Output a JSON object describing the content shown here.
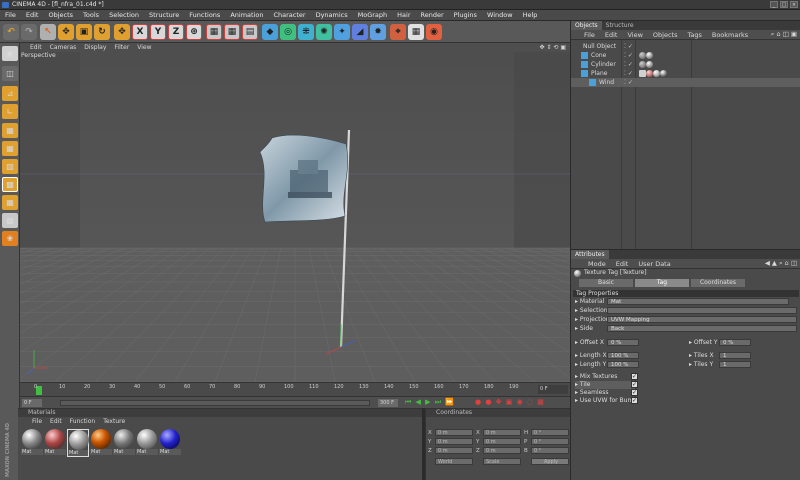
{
  "window": {
    "title": "CINEMA 4D - [fl_nfra_01.c4d *]",
    "controls": [
      "_",
      "□",
      "×"
    ]
  },
  "menu": [
    "File",
    "Edit",
    "Objects",
    "Tools",
    "Selection",
    "Structure",
    "Functions",
    "Animation",
    "Character",
    "Dynamics",
    "MoGraph",
    "Hair",
    "Render",
    "Plugins",
    "Window",
    "Help"
  ],
  "toolbar": {
    "axis_x": "X",
    "axis_y": "Y",
    "axis_z": "Z"
  },
  "viewport": {
    "menu": [
      "Edit",
      "Cameras",
      "Display",
      "Filter",
      "View"
    ],
    "label": "Perspective"
  },
  "timeline": {
    "ticks": [
      "0",
      "10",
      "20",
      "30",
      "40",
      "50",
      "60",
      "70",
      "80",
      "90",
      "100",
      "110",
      "120",
      "130",
      "140",
      "150",
      "160",
      "170",
      "180",
      "190"
    ],
    "end_frame": "0 F",
    "current_start": "0 F",
    "current_end": "300 F"
  },
  "materials": {
    "title": "Materials",
    "menu": [
      "File",
      "Edit",
      "Function",
      "Texture"
    ],
    "items": [
      {
        "label": "Mat",
        "color": "#c8c8c8"
      },
      {
        "label": "Mat",
        "color": "#d07070"
      },
      {
        "label": "Mat",
        "color": "#e0e0e0"
      },
      {
        "label": "Mat",
        "color": "#e07020"
      },
      {
        "label": "Mat",
        "color": "#b8b8b8"
      },
      {
        "label": "Mat",
        "color": "#d0d0d0"
      },
      {
        "label": "Mat",
        "color": "#2040d0"
      }
    ],
    "logo": "MAXON CINEMA 4D"
  },
  "coordinates": {
    "title": "Coordinates",
    "rows": [
      {
        "a": "X",
        "av": "0 m",
        "b": "X",
        "bv": "0 m",
        "c": "H",
        "cv": "0 °"
      },
      {
        "a": "Y",
        "av": "0 m",
        "b": "Y",
        "bv": "0 m",
        "c": "P",
        "cv": "0 °"
      },
      {
        "a": "Z",
        "av": "0 m",
        "b": "Z",
        "bv": "0 m",
        "c": "B",
        "cv": "0 °"
      }
    ],
    "mode1": "World",
    "mode2": "Scale",
    "apply": "Apply"
  },
  "objects": {
    "tabs": [
      "Objects",
      "Structure"
    ],
    "menu": [
      "File",
      "Edit",
      "View",
      "Objects",
      "Tags",
      "Bookmarks"
    ],
    "items": [
      {
        "name": "Null Object",
        "indent": 0
      },
      {
        "name": "Cone",
        "indent": 1
      },
      {
        "name": "Cylinder",
        "indent": 1
      },
      {
        "name": "Plane",
        "indent": 1
      },
      {
        "name": "Wind",
        "indent": 2
      }
    ]
  },
  "attributes": {
    "tab": "Attributes",
    "menu": [
      "Mode",
      "Edit",
      "User Data"
    ],
    "header": "Texture Tag [Texture]",
    "tabs": [
      "Basic",
      "Tag",
      "Coordinates"
    ],
    "section": "Tag Properties",
    "material_label": "Material",
    "material_value": "Mat",
    "selection_label": "Selection",
    "projection_label": "Projection",
    "projection_value": "UVW Mapping",
    "side_label": "Side",
    "side_value": "Back",
    "offset_x_label": "Offset X",
    "offset_x_value": "0 %",
    "offset_y_label": "Offset Y",
    "offset_y_value": "0 %",
    "length_x_label": "Length X",
    "length_x_value": "100 %",
    "length_y_label": "Length Y",
    "length_y_value": "100 %",
    "tiles_x_label": "Tiles X",
    "tiles_x_value": "1",
    "tiles_y_label": "Tiles Y",
    "tiles_y_value": "1",
    "mix_textures": "Mix Textures",
    "tile": "Tile",
    "seamless": "Seamless",
    "use_uvw": "Use UVW for Bump"
  }
}
